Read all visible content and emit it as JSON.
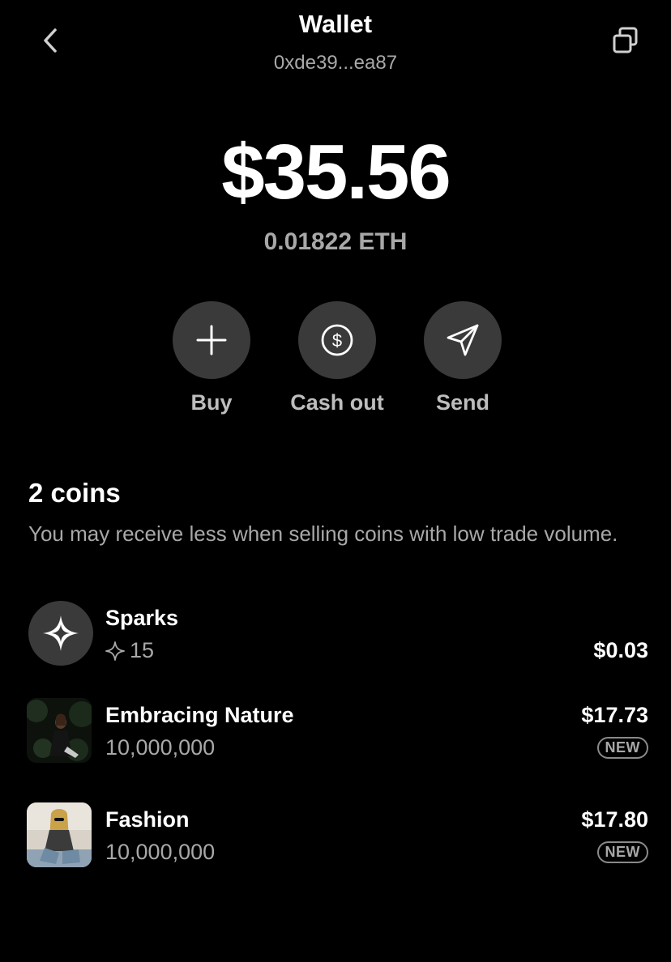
{
  "header": {
    "title": "Wallet",
    "address": "0xde39...ea87"
  },
  "balance": {
    "usd": "$35.56",
    "eth": "0.01822 ETH"
  },
  "actions": [
    {
      "label": "Buy",
      "icon": "plus-icon"
    },
    {
      "label": "Cash out",
      "icon": "dollar-circle-icon"
    },
    {
      "label": "Send",
      "icon": "paper-plane-icon"
    }
  ],
  "coins": {
    "title": "2 coins",
    "note": "You may receive less when selling coins with low trade volume.",
    "items": [
      {
        "name": "Sparks",
        "amount": "15",
        "value": "$0.03",
        "icon": "sparkle-icon",
        "badge": ""
      },
      {
        "name": "Embracing Nature",
        "amount": "10,000,000",
        "value": "$17.73",
        "badge": "NEW"
      },
      {
        "name": "Fashion",
        "amount": "10,000,000",
        "value": "$17.80",
        "badge": "NEW"
      }
    ]
  },
  "colors": {
    "background": "#000000",
    "button_bg": "#3a3a3a",
    "muted_text": "#a8a8a8"
  }
}
